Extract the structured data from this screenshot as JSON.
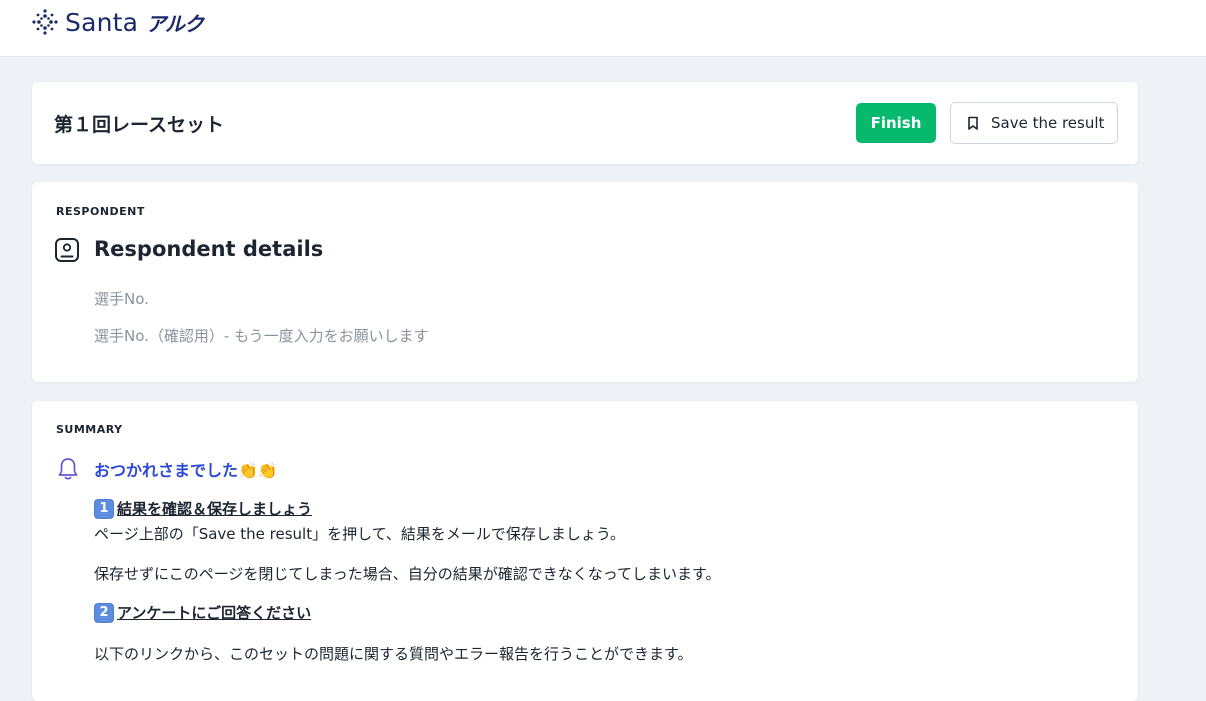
{
  "brand": {
    "name": "Santa",
    "sub": "アルク"
  },
  "header": {
    "title": "第１回レースセット",
    "finish_label": "Finish",
    "save_label": "Save the result"
  },
  "respondent": {
    "section_label": "RESPONDENT",
    "title": "Respondent details",
    "fields": [
      "選手No.",
      "選手No.（確認用）- もう一度入力をお願いします"
    ]
  },
  "summary": {
    "section_label": "SUMMARY",
    "heading": "おつかれさまでした👏👏",
    "step1": {
      "number": "1",
      "title": "結果を確認＆保存しましょう",
      "text": "ページ上部の「Save the result」を押して、結果をメールで保存しましょう。"
    },
    "note": "保存せずにこのページを閉じてしまった場合、自分の結果が確認できなくなってしまいます。",
    "step2": {
      "number": "2",
      "title": "アンケートにご回答ください",
      "text": "以下のリンクから、このセットの問題に関する質問やエラー報告を行うことができます。"
    }
  },
  "colors": {
    "accent_green": "#06b96d",
    "heading_blue": "#2b48d8",
    "brand_navy": "#1b2a6b",
    "keycap_blue": "#5b8ee0"
  },
  "icons": {
    "logo": "sparkle-dots-icon",
    "save": "bookmark-icon",
    "respondent": "user-badge-icon",
    "summary": "bell-icon"
  }
}
